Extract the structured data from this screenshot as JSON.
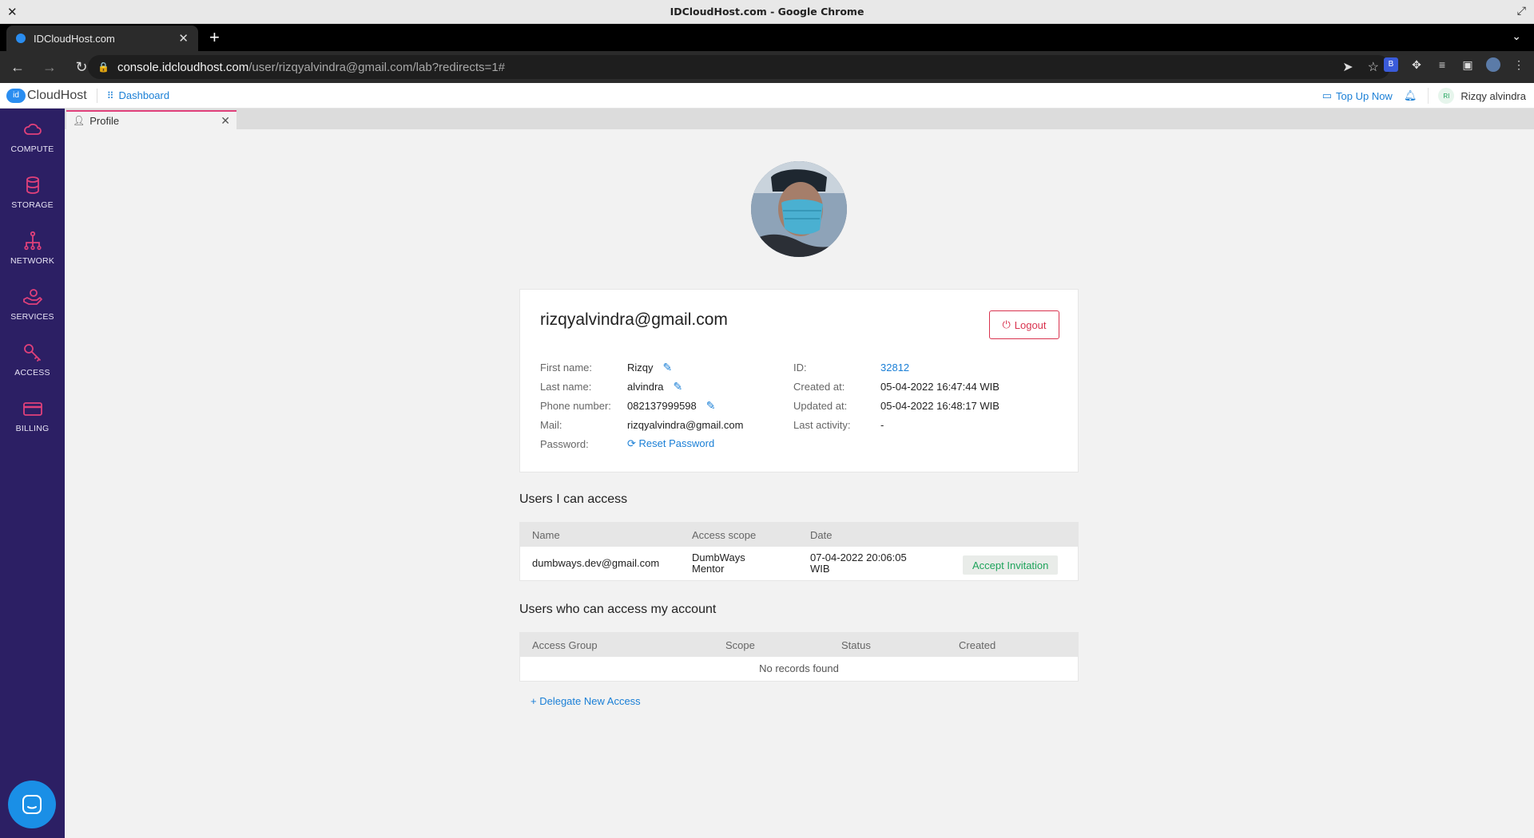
{
  "window": {
    "title": "IDCloudHost.com - Google Chrome"
  },
  "browser": {
    "tab_title": "IDCloudHost.com",
    "url_host": "console.idcloudhost.com",
    "url_path": "/user/rizqyalvindra@gmail.com/lab?redirects=1#"
  },
  "header": {
    "logo_badge": "id",
    "logo_text": "CloudHost",
    "dashboard": "Dashboard",
    "topup": "Top Up Now",
    "user_initials": "RI",
    "user_name": "Rizqy alvindra"
  },
  "sidebar": {
    "items": [
      {
        "label": "COMPUTE",
        "icon": "cloud-icon"
      },
      {
        "label": "STORAGE",
        "icon": "database-icon"
      },
      {
        "label": "NETWORK",
        "icon": "network-icon"
      },
      {
        "label": "SERVICES",
        "icon": "services-icon"
      },
      {
        "label": "ACCESS",
        "icon": "key-icon"
      },
      {
        "label": "BILLING",
        "icon": "card-icon"
      }
    ]
  },
  "page_tab": {
    "label": "Profile"
  },
  "profile": {
    "email": "rizqyalvindra@gmail.com",
    "logout": "Logout",
    "left": [
      {
        "label": "First name:",
        "value": "Rizqy"
      },
      {
        "label": "Last name:",
        "value": "alvindra"
      },
      {
        "label": "Phone number:",
        "value": "082137999598"
      },
      {
        "label": "Mail:",
        "value": "rizqyalvindra@gmail.com"
      },
      {
        "label": "Password:",
        "value": "Reset Password"
      }
    ],
    "right": [
      {
        "label": "ID:",
        "value": "32812"
      },
      {
        "label": "Created at:",
        "value": "05-04-2022 16:47:44 WIB"
      },
      {
        "label": "Updated at:",
        "value": "05-04-2022 16:48:17 WIB"
      },
      {
        "label": "Last activity:",
        "value": "-"
      }
    ]
  },
  "users_i_can_access": {
    "title": "Users I can access",
    "columns": [
      "Name",
      "Access scope",
      "Date"
    ],
    "rows": [
      {
        "name": "dumbways.dev@gmail.com",
        "scope_1": "DumbWays",
        "scope_2": "Mentor",
        "date_1": "07-04-2022 20:06:05",
        "date_2": "WIB",
        "action": "Accept Invitation"
      }
    ]
  },
  "users_who_can_access": {
    "title": "Users who can access my account",
    "columns": [
      "Access Group",
      "Scope",
      "Status",
      "Created"
    ],
    "empty": "No records found",
    "delegate": "Delegate New Access"
  },
  "colors": {
    "sidebar_bg": "#2c1f64",
    "sidebar_icon": "#e0407a",
    "link": "#1a7fd6",
    "logout": "#d9334f",
    "accept": "#1ea35b"
  }
}
